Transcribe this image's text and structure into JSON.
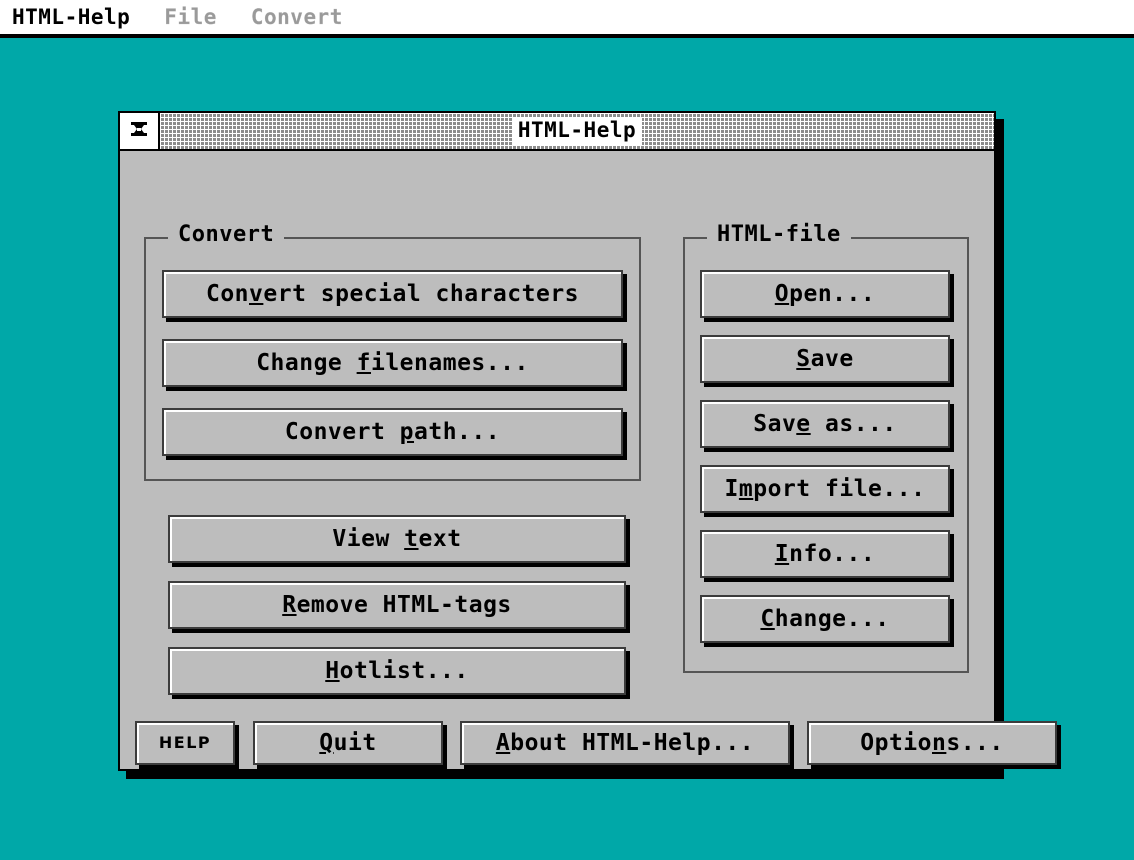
{
  "menubar": {
    "items": [
      {
        "label": "HTML-Help",
        "state": "active"
      },
      {
        "label": "File",
        "state": "disabled"
      },
      {
        "label": "Convert",
        "state": "disabled"
      }
    ]
  },
  "dialog": {
    "title": "HTML-Help",
    "close_icon": "close-box-icon",
    "groups": {
      "convert": {
        "title": "Convert",
        "buttons": [
          {
            "pre": "Con",
            "acc": "v",
            "post": "ert special characters"
          },
          {
            "pre": "Change ",
            "acc": "f",
            "post": "ilenames..."
          },
          {
            "pre": "Convert ",
            "acc": "p",
            "post": "ath..."
          }
        ]
      },
      "htmlfile": {
        "title": "HTML-file",
        "buttons": [
          {
            "pre": "",
            "acc": "O",
            "post": "pen..."
          },
          {
            "pre": "",
            "acc": "S",
            "post": "ave"
          },
          {
            "pre": "Sav",
            "acc": "e",
            "post": " as..."
          },
          {
            "pre": "I",
            "acc": "m",
            "post": "port file..."
          },
          {
            "pre": "",
            "acc": "I",
            "post": "nfo..."
          },
          {
            "pre": "",
            "acc": "C",
            "post": "hange..."
          }
        ]
      }
    },
    "mid_buttons": [
      {
        "pre": "View ",
        "acc": "t",
        "post": "ext"
      },
      {
        "pre": "",
        "acc": "R",
        "post": "emove HTML-tags"
      },
      {
        "pre": "",
        "acc": "H",
        "post": "otlist..."
      }
    ],
    "bottom_buttons": {
      "help": {
        "label": "HELP"
      },
      "quit": {
        "pre": "",
        "acc": "Q",
        "post": "uit"
      },
      "about": {
        "pre": "",
        "acc": "A",
        "post": "bout HTML-Help..."
      },
      "options": {
        "pre": "Optio",
        "acc": "n",
        "post": "s..."
      }
    }
  },
  "colors": {
    "desktop": "#00a8a8",
    "dialog_face": "#bdbdbd",
    "ink": "#000000",
    "menubar_bg": "#ffffff",
    "disabled_text": "#9a9a9a",
    "group_border": "#555555"
  }
}
